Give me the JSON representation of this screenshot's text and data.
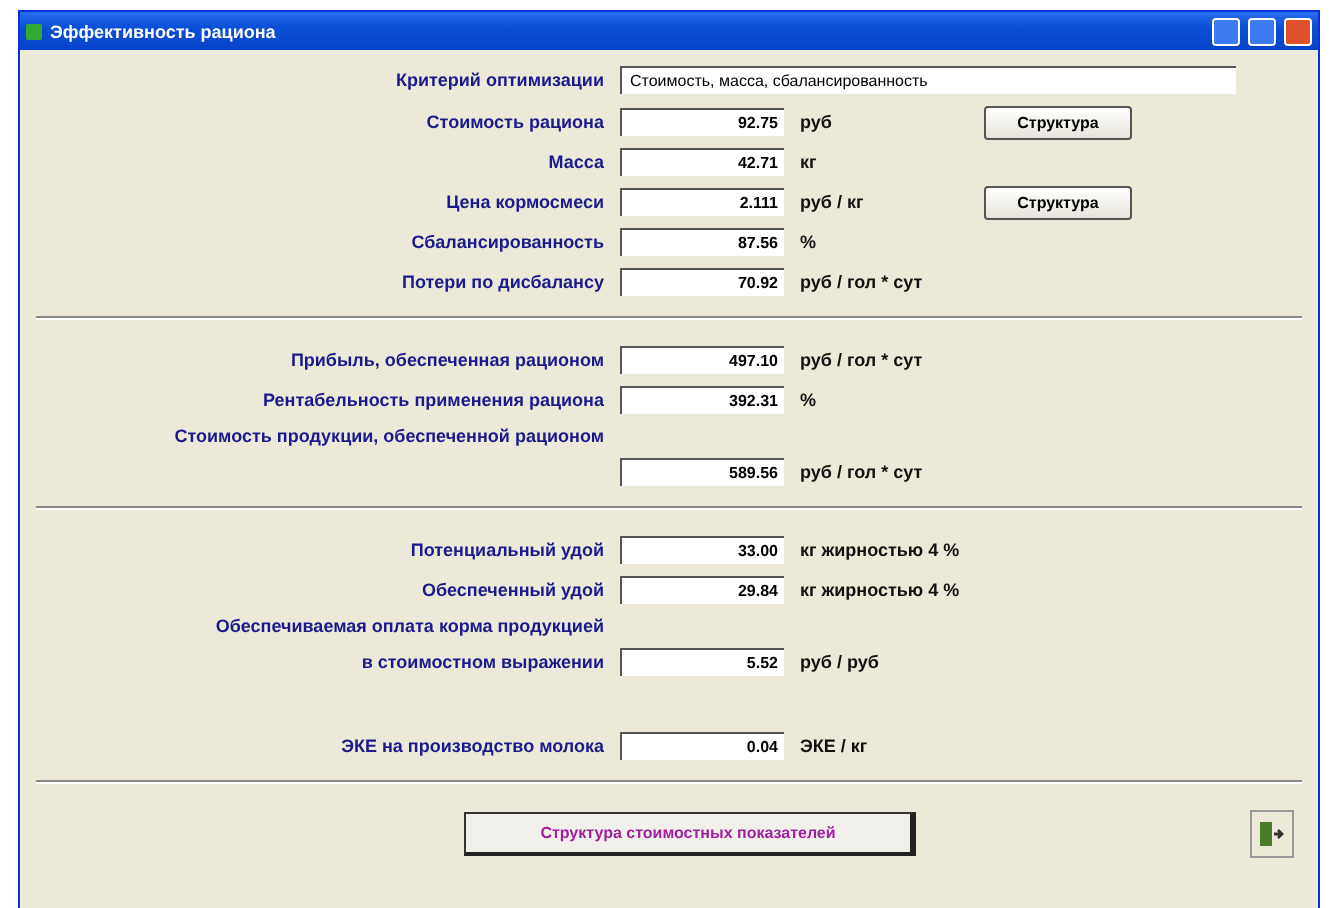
{
  "window": {
    "title": "Эффективность рациона"
  },
  "criterion": {
    "label": "Критерий оптимизации",
    "value": "Стоимость, масса, сбалансированность"
  },
  "sections": [
    {
      "rows": [
        {
          "kind": "field",
          "label": "Стоимость рациона",
          "value": "92.75",
          "unit": "руб",
          "button": "Структура"
        },
        {
          "kind": "field",
          "label": "Масса",
          "value": "42.71",
          "unit": "кг"
        },
        {
          "kind": "field",
          "label": "Цена кормосмеси",
          "value": "2.111",
          "unit": "руб / кг",
          "button": "Структура"
        },
        {
          "kind": "field",
          "label": "Сбалансированность",
          "value": "87.56",
          "unit": "%"
        },
        {
          "kind": "field",
          "label": "Потери по дисбалансу",
          "value": "70.92",
          "unit": "руб / гол * сут"
        }
      ]
    },
    {
      "rows": [
        {
          "kind": "field",
          "label": "Прибыль, обеспеченная рационом",
          "value": "497.10",
          "unit": "руб / гол * сут"
        },
        {
          "kind": "field",
          "label": "Рентабельность применения рациона",
          "value": "392.31",
          "unit": "%"
        },
        {
          "kind": "heading",
          "label": "Стоимость продукции, обеспеченной рационом"
        },
        {
          "kind": "field",
          "label": "",
          "value": "589.56",
          "unit": "руб / гол * сут"
        }
      ]
    },
    {
      "rows": [
        {
          "kind": "field",
          "label": "Потенциальный удой",
          "value": "33.00",
          "unit": "кг жирностью 4 %"
        },
        {
          "kind": "field",
          "label": "Обеспеченный удой",
          "value": "29.84",
          "unit": "кг жирностью 4 %"
        },
        {
          "kind": "heading",
          "label": "Обеспечиваемая оплата корма продукцией"
        },
        {
          "kind": "field",
          "label": "в стоимостном выражении",
          "value": "5.52",
          "unit": "руб / руб"
        },
        {
          "kind": "gap"
        },
        {
          "kind": "field",
          "label": "ЭКЕ на производство молока",
          "value": "0.04",
          "unit": "ЭКЕ / кг"
        }
      ]
    }
  ],
  "footer": {
    "button": "Структура стоимостных показателей"
  }
}
